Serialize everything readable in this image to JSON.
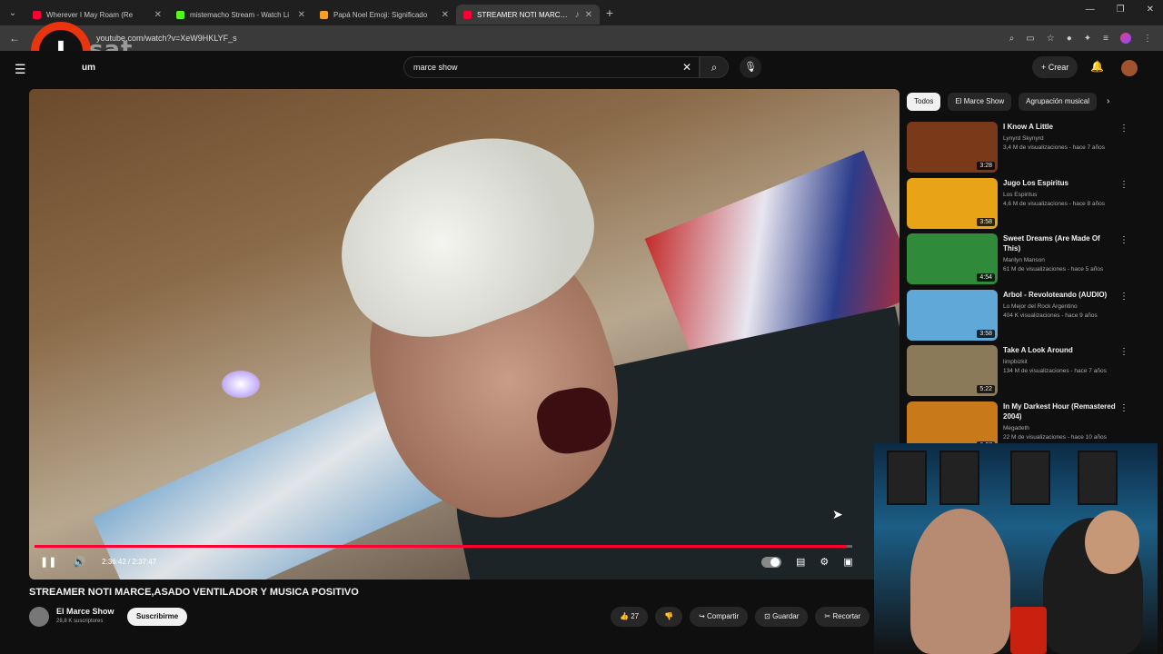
{
  "browser": {
    "tabs": [
      {
        "title": "Wherever I May Roam (Re",
        "color": "#ff0033"
      },
      {
        "title": "mistemacho Stream - Watch Li",
        "color": "#53fc18"
      },
      {
        "title": "Papá Noel Emoji: Significado",
        "color": "#f4a12a"
      },
      {
        "title": "STREAMER NOTI MARCE,AS",
        "color": "#ff0033"
      }
    ],
    "url": "youtube.com/watch?v=XeW9HKLYF_s"
  },
  "overlay_logo": {
    "letter": "I",
    "text": "sat"
  },
  "youtube": {
    "brand": "um",
    "search_value": "marce show",
    "create_label": "Crear"
  },
  "player": {
    "time": "2:36:42 / 2:37:47",
    "progress": 0.993
  },
  "video": {
    "title": "STREAMER NOTI MARCE,ASADO VENTILADOR Y MUSICA POSITIVO",
    "channel": "El Marce Show",
    "subscribers": "28,8 K suscriptores",
    "subscribe_label": "Suscribirme",
    "likes": "27",
    "share_label": "Compartir",
    "save_label": "Guardar",
    "clip_label": "Recortar"
  },
  "chips": [
    "Todos",
    "El Marce Show",
    "Agrupación musical"
  ],
  "recommendations": [
    {
      "title": "I Know A Little",
      "channel": "Lynyrd Skynyrd",
      "meta": "3,4 M de visualizaciones - hace 7 años",
      "duration": "3:28",
      "thumb": "#7a3a1a"
    },
    {
      "title": "Jugo  Los Espiritus",
      "channel": "Los Espiritus",
      "meta": "4,6 M de visualizaciones - hace 8 años",
      "duration": "3:58",
      "thumb": "#e8a416"
    },
    {
      "title": "Sweet Dreams (Are Made Of This)",
      "channel": "Marilyn Manson",
      "meta": "61 M de visualizaciones - hace 5 años",
      "duration": "4:54",
      "thumb": "#2f8a3a"
    },
    {
      "title": "Arbol - Revoloteando (AUDIO)",
      "channel": "Lo Mejor del Rock Argentino",
      "meta": "404 K visualizaciones - hace 9 años",
      "duration": "3:58",
      "thumb": "#5fa8d8"
    },
    {
      "title": "Take A Look Around",
      "channel": "limpbizkit",
      "meta": "134 M de visualizaciones - hace 7 años",
      "duration": "5:22",
      "thumb": "#8a7a5a"
    },
    {
      "title": "In My Darkest Hour (Remastered 2004)",
      "channel": "Megadeth",
      "meta": "22 M de visualizaciones - hace 10 años",
      "duration": "6:27",
      "thumb": "#c87a1a"
    }
  ]
}
